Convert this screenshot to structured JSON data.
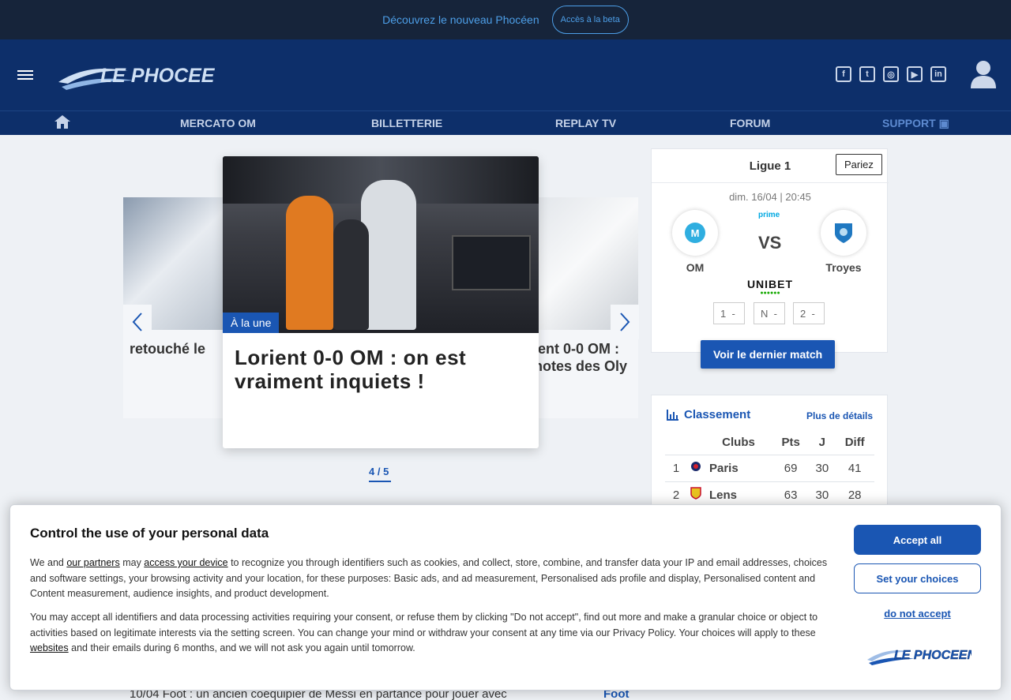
{
  "topbar": {
    "promo": "Découvrez le nouveau Phocéen",
    "beta_button": "Accès à la beta"
  },
  "header": {
    "logo_alt": "LE PHOCEEN"
  },
  "social": {
    "icons": [
      "facebook-icon",
      "twitter-icon",
      "instagram-icon",
      "youtube-icon",
      "linkedin-icon"
    ]
  },
  "nav": {
    "items": [
      "MERCATO OM",
      "BILLETTERIE",
      "REPLAY TV",
      "FORUM",
      "SUPPORT"
    ]
  },
  "carousel": {
    "left_title": "retouché le",
    "label": "À la une",
    "main_title": "Lorient 0-0 OM : on est vraiment inquiets !",
    "right_title_1": "ient 0-0 OM :",
    "right_title_2": "notes des Oly",
    "pager": "4 / 5"
  },
  "match": {
    "league": "Ligue 1",
    "bet_button": "Pariez",
    "date": "dim. 16/04 | 20:45",
    "broadcaster": "prime",
    "home": "OM",
    "away": "Troyes",
    "vs": "VS",
    "bookmaker": "UNIBET",
    "odds": [
      "1",
      "N",
      "2"
    ],
    "odds_value": "-",
    "last_match_button": "Voir le dernier match"
  },
  "standings": {
    "title": "Classement",
    "more": "Plus de détails",
    "headers": [
      "Clubs",
      "Pts",
      "J",
      "Diff"
    ],
    "rows": [
      {
        "rank": "1",
        "club": "Paris",
        "pts": "69",
        "j": "30",
        "diff": "41"
      },
      {
        "rank": "2",
        "club": "Lens",
        "pts": "63",
        "j": "30",
        "diff": "28"
      }
    ]
  },
  "news": {
    "line": "10/04  Foot : un ancien coéquipier de Messi en partance pour jouer avec",
    "tag": "Foot"
  },
  "consent": {
    "title": "Control the use of your personal data",
    "p1_a": "We and ",
    "p1_partners": "our partners",
    "p1_b": " may ",
    "p1_access": "access your device",
    "p1_c": " to recognize you through identifiers such as cookies, and collect, store, combine, and transfer data your IP and email addresses, choices and software settings, your browsing activity and your location, for these purposes: Basic ads, and ad measurement, Personalised ads profile and display, Personalised content and Content measurement, audience insights, and product development.",
    "p2_a": "You may accept all identifiers and data processing activities requiring your consent, or refuse them by clicking \"Do not accept\", find out more and make a granular choice or object to activities based on legitimate interests via the setting screen. You can change your mind or withdraw your consent at any time via our Privacy Policy. Your choices will apply to these ",
    "p2_websites": "websites",
    "p2_b": " and their emails during 6 months, and we will not ask you again until tomorrow.",
    "accept": "Accept all",
    "choices": "Set your choices",
    "reject": "do not accept"
  },
  "colors": {
    "primary": "#1a56b3",
    "header": "#0d2f6a",
    "topbar": "#16243a"
  }
}
